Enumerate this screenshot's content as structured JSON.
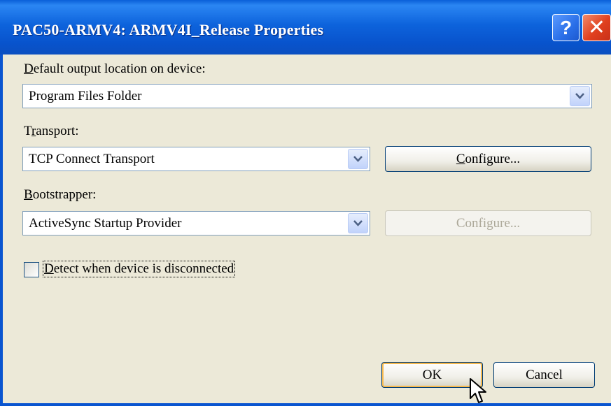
{
  "window": {
    "title": "PAC50-ARMV4: ARMV4I_Release Properties"
  },
  "titlebar": {
    "help_glyph": "?",
    "close_glyph": "✕"
  },
  "output_location": {
    "label_prefix": "",
    "label_accel": "D",
    "label_rest": "efault output location on device:",
    "value": "Program Files Folder"
  },
  "transport": {
    "label_prefix": "T",
    "label_accel": "r",
    "label_rest": "ansport:",
    "value": "TCP Connect Transport",
    "configure_prefix": "",
    "configure_accel": "C",
    "configure_rest": "onfigure..."
  },
  "bootstrapper": {
    "label_prefix": "",
    "label_accel": "B",
    "label_rest": "ootstrapper:",
    "value": "ActiveSync Startup Provider",
    "configure_label": "Configure..."
  },
  "detect_disconnect": {
    "label_accel": "D",
    "label_rest": "etect when device is disconnected",
    "checked": false
  },
  "buttons": {
    "ok": "OK",
    "cancel": "Cancel"
  },
  "colors": {
    "titlebar": "#0a5fd8",
    "dialog_bg": "#ece9d8",
    "close": "#e0401e"
  }
}
